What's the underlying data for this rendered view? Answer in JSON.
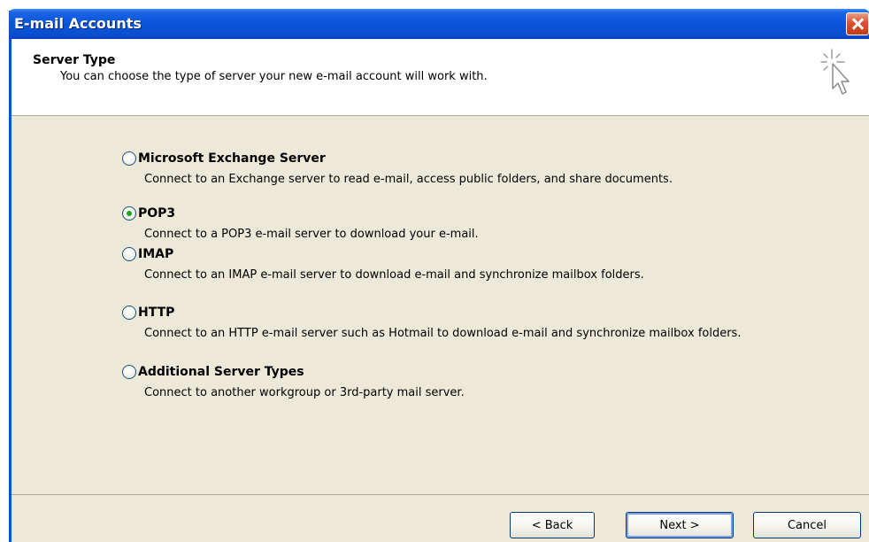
{
  "window": {
    "title": "E-mail Accounts"
  },
  "header": {
    "title": "Server Type",
    "subtitle": "You can choose the type of server your new e-mail account will work with."
  },
  "options": [
    {
      "label": "Microsoft Exchange Server",
      "description": "Connect to an Exchange server to read e-mail, access public folders, and share documents.",
      "checked": false
    },
    {
      "label": "POP3",
      "description": "Connect to a POP3 e-mail server to download your e-mail.",
      "checked": true
    },
    {
      "label": "IMAP",
      "description": "Connect to an IMAP e-mail server to download e-mail and synchronize mailbox folders.",
      "checked": false
    },
    {
      "label": "HTTP",
      "description": "Connect to an HTTP e-mail server such as Hotmail to download e-mail and synchronize mailbox folders.",
      "checked": false
    },
    {
      "label": "Additional Server Types",
      "description": "Connect to another workgroup or 3rd-party mail server.",
      "checked": false
    }
  ],
  "buttons": {
    "back": "< Back",
    "next": "Next >",
    "cancel": "Cancel"
  },
  "icons": {
    "close": "close-icon",
    "wizard": "cursor-sparkle-icon"
  },
  "colors": {
    "titlebar": "#0a54d8",
    "close": "#d8522e",
    "dialog_bg": "#ece9d8",
    "radio_checked": "#21a121"
  }
}
